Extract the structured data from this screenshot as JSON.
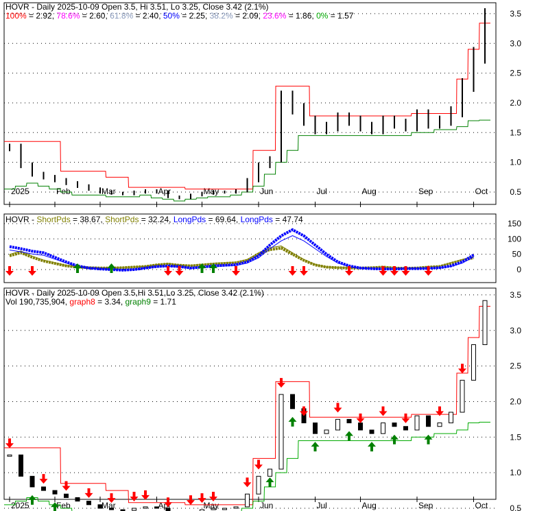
{
  "chart_data": [
    {
      "type": "line",
      "title": "HOVR - Daily 2025-10-09 Open 3.5, Hi 3.51, Lo 3.25, Close 3.42 (2.1%)",
      "fib": [
        {
          "label": "100%",
          "value": "2.92",
          "color": "#ff0000"
        },
        {
          "label": "78.6%",
          "value": "2.60",
          "color": "#ff00ff"
        },
        {
          "label": "61.8%",
          "value": "2.40",
          "color": "#8899bb"
        },
        {
          "label": "50%",
          "value": "2.25",
          "color": "#0000ff"
        },
        {
          "label": "38.2%",
          "value": "2.09",
          "color": "#8899bb"
        },
        {
          "label": "23.6%",
          "value": "1.86",
          "color": "#ff00ff"
        },
        {
          "label": "0%",
          "value": "1.57",
          "color": "#00aa00"
        }
      ],
      "yticks": [
        "0.5",
        "1.0",
        "1.5",
        "2.0",
        "2.5",
        "3.0",
        "3.5"
      ],
      "ylim": [
        0.3,
        3.6
      ]
    },
    {
      "type": "line",
      "title": "HOVR",
      "legend": [
        {
          "label": "ShortPds",
          "value": "38.67",
          "color": "#808000"
        },
        {
          "label": "ShortPds",
          "value": "32.24",
          "color": "#808000"
        },
        {
          "label": "LongPds",
          "value": "69.64",
          "color": "#0000ff"
        },
        {
          "label": "LongPds",
          "value": "47.74",
          "color": "#0000ff"
        }
      ],
      "yticks": [
        "0",
        "50",
        "100",
        "150"
      ],
      "ylim": [
        -30,
        160
      ],
      "short": [
        45,
        55,
        40,
        28,
        20,
        12,
        8,
        6,
        5,
        5,
        6,
        8,
        10,
        15,
        18,
        14,
        12,
        15,
        18,
        20,
        22,
        30,
        50,
        65,
        70,
        50,
        30,
        15,
        8,
        6,
        5,
        5,
        6,
        8,
        5,
        4,
        5,
        8,
        10,
        20,
        30,
        38.67
      ],
      "long": [
        75,
        68,
        60,
        55,
        40,
        25,
        12,
        5,
        2,
        0,
        -2,
        0,
        5,
        10,
        12,
        10,
        5,
        8,
        12,
        14,
        16,
        25,
        45,
        80,
        110,
        130,
        110,
        80,
        50,
        25,
        12,
        5,
        3,
        2,
        2,
        3,
        3,
        4,
        6,
        12,
        25,
        47.74
      ],
      "sell": [
        0,
        2,
        14,
        15,
        20,
        25,
        26,
        30,
        33,
        34,
        35,
        37
      ],
      "buy": [
        6,
        9,
        17,
        18
      ]
    },
    {
      "type": "candlestick",
      "title": "HOVR - Daily 2025-10-09 Open 3.5,Hi 3.51,Lo 3.25, Close 3.42 (2.1%)",
      "vol_label": "Vol 190,735,904",
      "graph8": [
        1.35,
        1.35,
        1.35,
        1.35,
        1.35,
        0.85,
        0.85,
        0.85,
        0.85,
        0.75,
        0.75,
        0.58,
        0.58,
        0.58,
        0.58,
        0.58,
        0.55,
        0.55,
        0.55,
        0.55,
        0.55,
        0.55,
        1.2,
        1.2,
        2.28,
        2.28,
        2.28,
        1.78,
        1.78,
        1.78,
        1.78,
        1.78,
        1.78,
        1.78,
        1.78,
        1.78,
        1.82,
        1.82,
        1.82,
        1.82,
        2.4,
        2.9,
        3.34
      ],
      "graph9": [
        0.55,
        0.6,
        0.65,
        0.6,
        0.55,
        0.5,
        0.45,
        0.45,
        0.45,
        0.42,
        0.42,
        0.42,
        0.45,
        0.4,
        0.38,
        0.35,
        0.38,
        0.4,
        0.42,
        0.42,
        0.45,
        0.5,
        0.6,
        0.8,
        1.0,
        1.2,
        1.45,
        1.45,
        1.45,
        1.45,
        1.45,
        1.45,
        1.45,
        1.45,
        1.45,
        1.45,
        1.5,
        1.5,
        1.55,
        1.55,
        1.6,
        1.7,
        1.71
      ],
      "xticks": [
        "2025",
        "Feb",
        "Mar",
        "Apr",
        "May",
        "Jun",
        "Jul",
        "Aug",
        "Sep",
        "Oct"
      ],
      "yticks": [
        "0.5",
        "1.0",
        "1.5",
        "2.0",
        "2.5",
        "3.0",
        "3.5"
      ],
      "ylim": [
        0.4,
        3.55
      ],
      "close": [
        1.25,
        0.95,
        0.8,
        0.75,
        0.7,
        0.65,
        0.6,
        0.55,
        0.5,
        0.48,
        0.47,
        0.5,
        0.52,
        0.5,
        0.42,
        0.4,
        0.45,
        0.48,
        0.5,
        0.5,
        0.52,
        0.7,
        0.95,
        1.05,
        2.1,
        1.9,
        1.7,
        1.55,
        1.6,
        1.75,
        1.7,
        1.6,
        1.55,
        1.7,
        1.65,
        1.6,
        1.8,
        1.65,
        1.7,
        1.85,
        2.3,
        2.8,
        3.42
      ],
      "sell": [
        0,
        3,
        5,
        7,
        9,
        11,
        12,
        14,
        16,
        17,
        18,
        21,
        22,
        24,
        26,
        29,
        31,
        33,
        35,
        38,
        40
      ],
      "buy": [
        2,
        4,
        7,
        10,
        13,
        15,
        20,
        23,
        25,
        27,
        30,
        32,
        34,
        37
      ]
    }
  ]
}
